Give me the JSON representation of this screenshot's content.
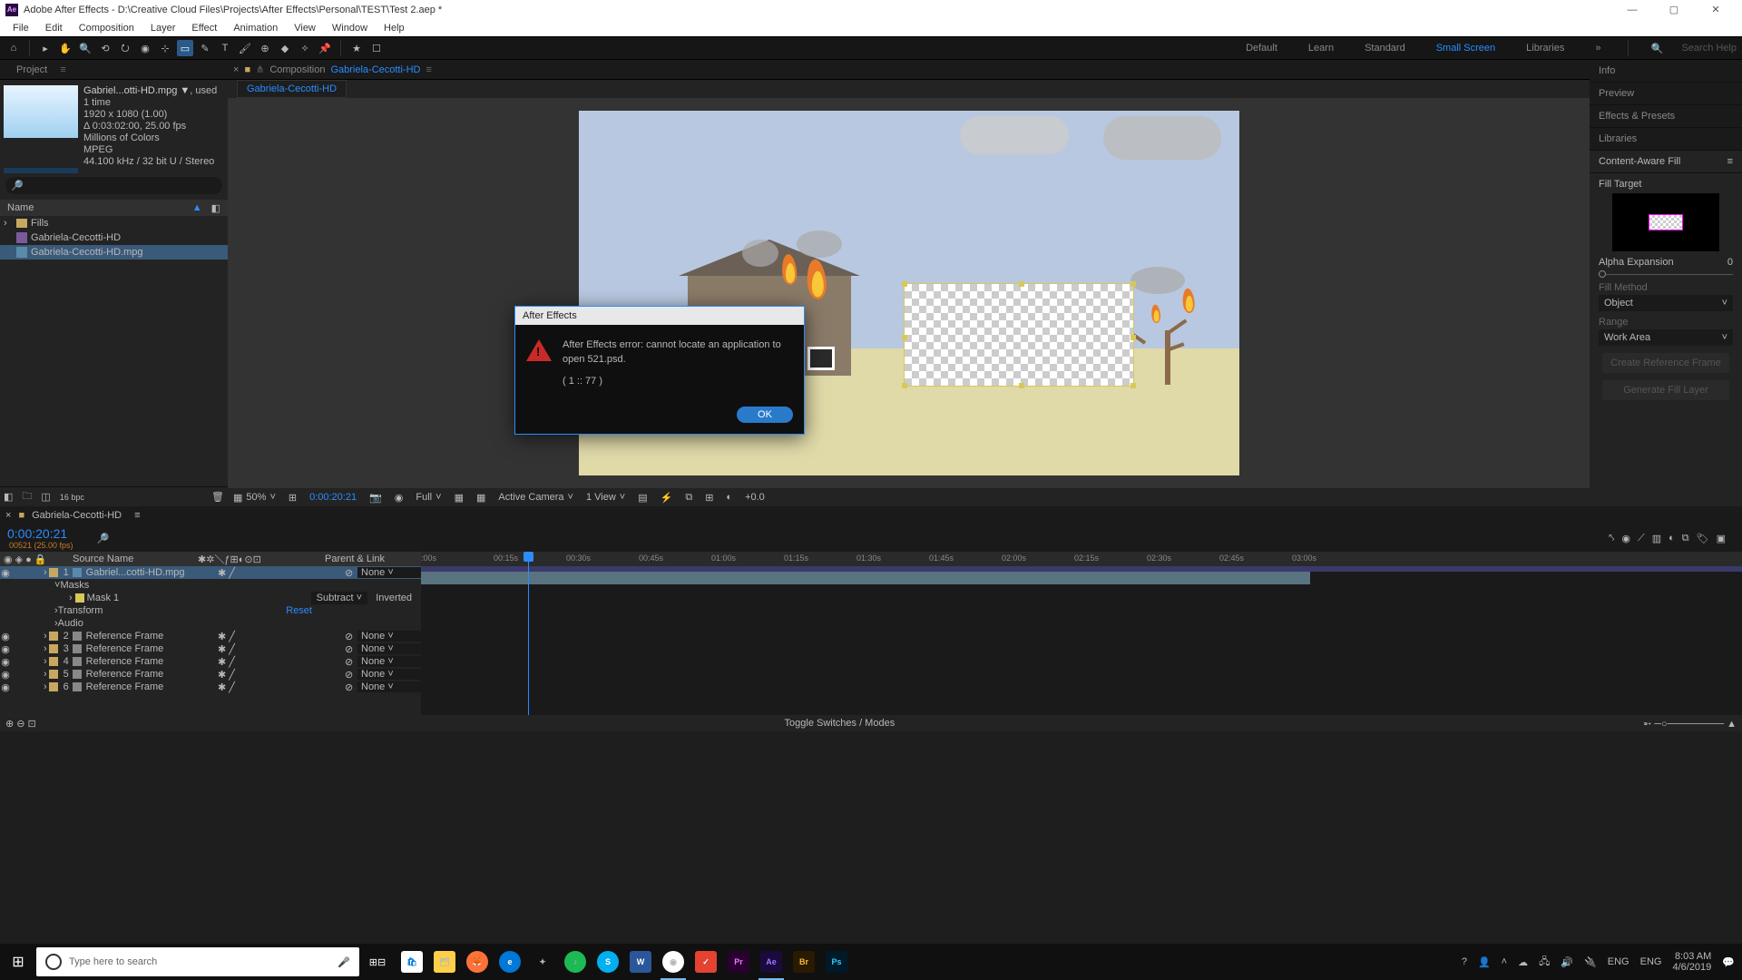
{
  "titlebar": {
    "app": "Ae",
    "title": "Adobe After Effects - D:\\Creative Cloud Files\\Projects\\After Effects\\Personal\\TEST\\Test 2.aep *"
  },
  "menu": [
    "File",
    "Edit",
    "Composition",
    "Layer",
    "Effect",
    "Animation",
    "View",
    "Window",
    "Help"
  ],
  "workspaces": [
    "Default",
    "Learn",
    "Standard",
    "Small Screen",
    "Libraries"
  ],
  "workspace_active": "Small Screen",
  "search_help_placeholder": "Search Help",
  "project": {
    "tab": "Project",
    "asset": {
      "name": "Gabriel...otti-HD.mpg ▼",
      "usage": ", used 1 time",
      "dim": "1920 x 1080 (1.00)",
      "dur": "Δ 0:03:02:00, 25.00 fps",
      "colors": "Millions of Colors",
      "codec": "MPEG",
      "audio": "44.100 kHz / 32 bit U / Stereo"
    },
    "header": "Name",
    "items": [
      {
        "type": "folder",
        "label": "Fills"
      },
      {
        "type": "comp",
        "label": "Gabriela-Cecotti-HD"
      },
      {
        "type": "footage",
        "label": "Gabriela-Cecotti-HD.mpg",
        "selected": true
      }
    ],
    "bpc": "16 bpc"
  },
  "composition": {
    "label": "Composition",
    "name": "Gabriela-Cecotti-HD",
    "tab": "Gabriela-Cecotti-HD"
  },
  "viewer_footer": {
    "zoom": "50%",
    "time": "0:00:20:21",
    "res": "Full",
    "camera": "Active Camera",
    "view": "1 View",
    "exposure": "+0.0"
  },
  "right_panels": [
    "Info",
    "Preview",
    "Effects & Presets",
    "Libraries"
  ],
  "caf": {
    "title": "Content-Aware Fill",
    "target": "Fill Target",
    "alpha": "Alpha Expansion",
    "alpha_val": "0",
    "method": "Fill Method",
    "method_val": "Object",
    "range": "Range",
    "range_val": "Work Area",
    "btn1": "Create Reference Frame",
    "btn2": "Generate Fill Layer"
  },
  "timeline": {
    "tab": "Gabriela-Cecotti-HD",
    "timecode": "0:00:20:21",
    "sub": "00521 (25.00 fps)",
    "col_src": "Source Name",
    "col_parent": "Parent & Link",
    "ticks": [
      ":00s",
      "00:15s",
      "00:30s",
      "00:45s",
      "01:00s",
      "01:15s",
      "01:30s",
      "01:45s",
      "02:00s",
      "02:15s",
      "02:30s",
      "02:45s",
      "03:00s"
    ],
    "layers": [
      {
        "idx": "1",
        "name": "Gabriel...cotti-HD.mpg",
        "parent": "None",
        "selected": true
      },
      {
        "sub": "Masks"
      },
      {
        "sub": "Mask 1",
        "mode": "Subtract",
        "inv": "Inverted"
      },
      {
        "sub": "Transform",
        "val": "Reset"
      },
      {
        "sub": "Audio"
      },
      {
        "idx": "2",
        "name": "Reference Frame",
        "parent": "None"
      },
      {
        "idx": "3",
        "name": "Reference Frame",
        "parent": "None"
      },
      {
        "idx": "4",
        "name": "Reference Frame",
        "parent": "None"
      },
      {
        "idx": "5",
        "name": "Reference Frame",
        "parent": "None"
      },
      {
        "idx": "6",
        "name": "Reference Frame",
        "parent": "None"
      }
    ],
    "toggle": "Toggle Switches / Modes"
  },
  "dialog": {
    "title": "After Effects",
    "msg": "After Effects error: cannot locate an application to open 521.psd.",
    "code": "( 1 :: 77 )",
    "ok": "OK"
  },
  "taskbar": {
    "search": "Type here to search",
    "lang1": "ENG",
    "lang2": "ENG",
    "time": "8:03 AM",
    "date": "4/6/2019"
  }
}
